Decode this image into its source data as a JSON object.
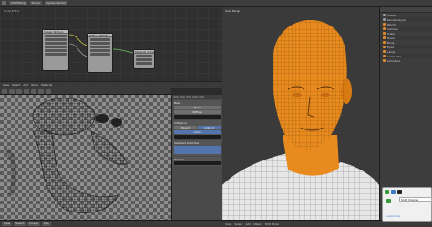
{
  "topbar": {
    "render_engine": "Cycles Render",
    "layout": "UV Editing",
    "scene": "Scene"
  },
  "node_editor": {
    "label": "Node Editor",
    "footer": [
      "View",
      "Select",
      "Add",
      "Node",
      "Material"
    ],
    "nodes": [
      {
        "name": "Image Texture"
      },
      {
        "name": "Diffuse BSDF"
      },
      {
        "name": "Material Output"
      }
    ]
  },
  "uv_editor": {
    "footer": [
      "View",
      "Select",
      "Image",
      "UVs"
    ]
  },
  "properties": {
    "section_title": "Bake",
    "bake_button": "Bake",
    "bake_type": "Diffuse",
    "sections": [
      "Influence",
      "Selected to Active",
      "Output"
    ],
    "options": [
      "Direct",
      "Indirect",
      "Color"
    ]
  },
  "viewport": {
    "label": "User Persp",
    "footer": [
      "View",
      "Select",
      "Add",
      "Object",
      "Edit Mode"
    ]
  },
  "outliner": {
    "items": [
      "Scene",
      "RenderLayers",
      "World",
      "Camera",
      "Cube",
      "Head",
      "Body",
      "Eyes",
      "Lamp",
      "Lamp.001",
      "Armature"
    ]
  },
  "popup": {
    "tooltip": "Solid Display",
    "label": "Customize",
    "icon_colors": [
      "#3a9a3a",
      "#3a7ac8",
      "#222222",
      "#3a9a3a"
    ]
  },
  "colors": {
    "accent": "#e88a1e",
    "selection": "#5474ad"
  }
}
